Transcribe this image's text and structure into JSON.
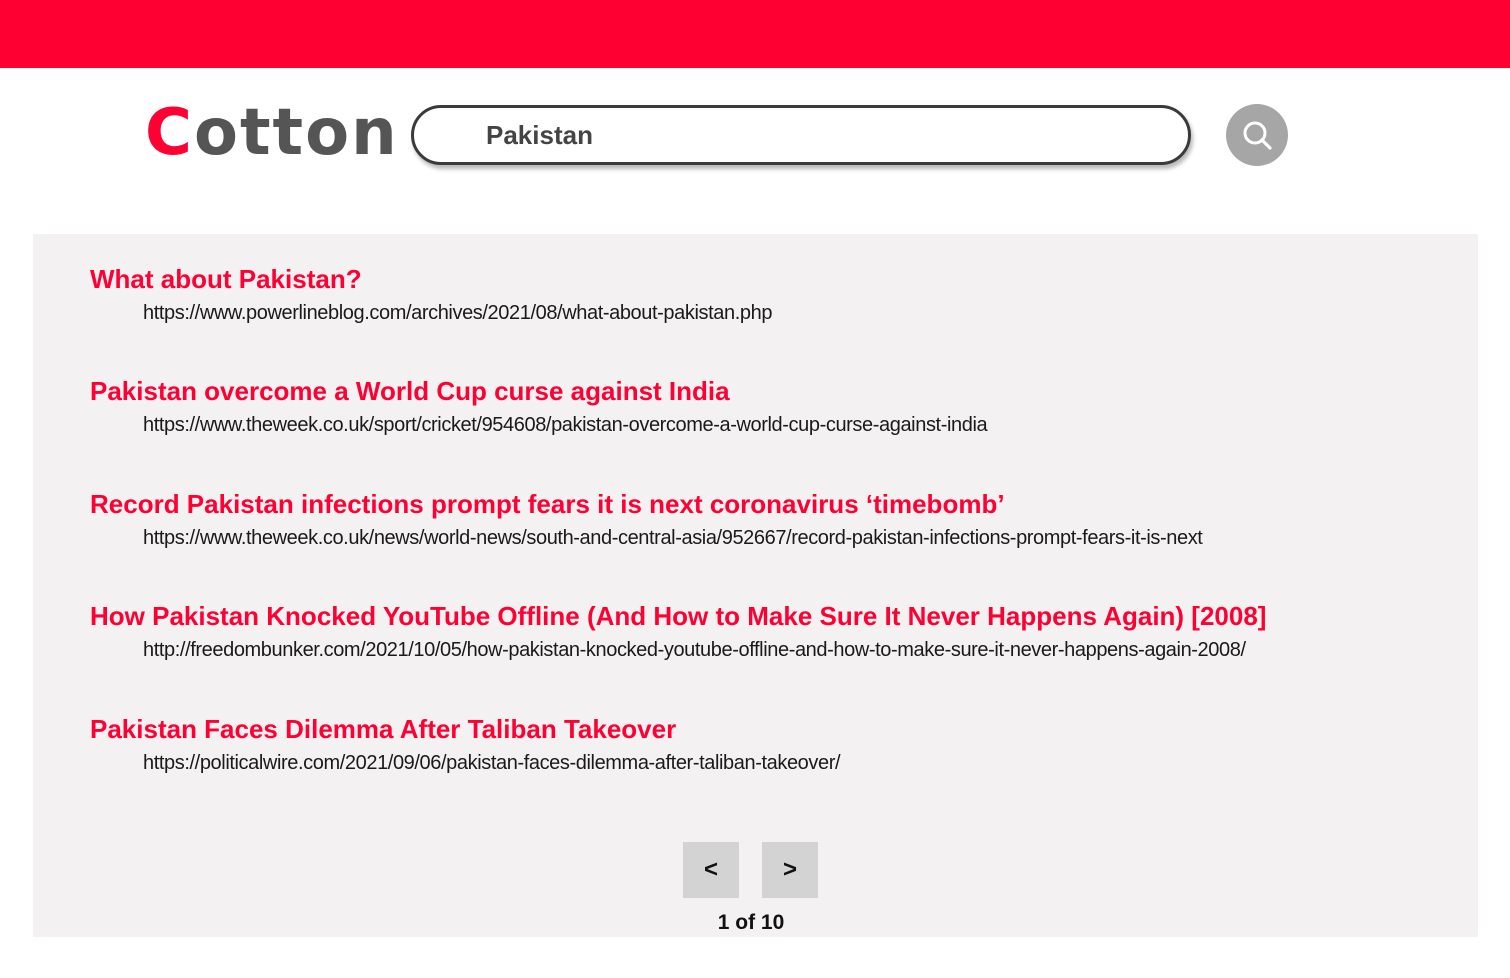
{
  "brand": {
    "logo_first": "C",
    "logo_rest": "otton",
    "accent_color": "#ff0033"
  },
  "search": {
    "query": "Pakistan",
    "button_icon": "search-icon"
  },
  "results": [
    {
      "title": "What about Pakistan?",
      "url": "https://www.powerlineblog.com/archives/2021/08/what-about-pakistan.php"
    },
    {
      "title": "Pakistan overcome a World Cup curse against India",
      "url": "https://www.theweek.co.uk/sport/cricket/954608/pakistan-overcome-a-world-cup-curse-against-india"
    },
    {
      "title": "Record Pakistan infections prompt fears it is next coronavirus ‘timebomb’",
      "url": "https://www.theweek.co.uk/news/world-news/south-and-central-asia/952667/record-pakistan-infections-prompt-fears-it-is-next"
    },
    {
      "title": "How Pakistan Knocked YouTube Offline (And How to Make Sure It Never Happens Again) [2008]",
      "url": "http://freedombunker.com/2021/10/05/how-pakistan-knocked-youtube-offline-and-how-to-make-sure-it-never-happens-again-2008/"
    },
    {
      "title": "Pakistan Faces Dilemma After Taliban Takeover",
      "url": "https://politicalwire.com/2021/09/06/pakistan-faces-dilemma-after-taliban-takeover/"
    }
  ],
  "pagination": {
    "prev_label": "<",
    "next_label": ">",
    "page_text": "1 of 10"
  }
}
